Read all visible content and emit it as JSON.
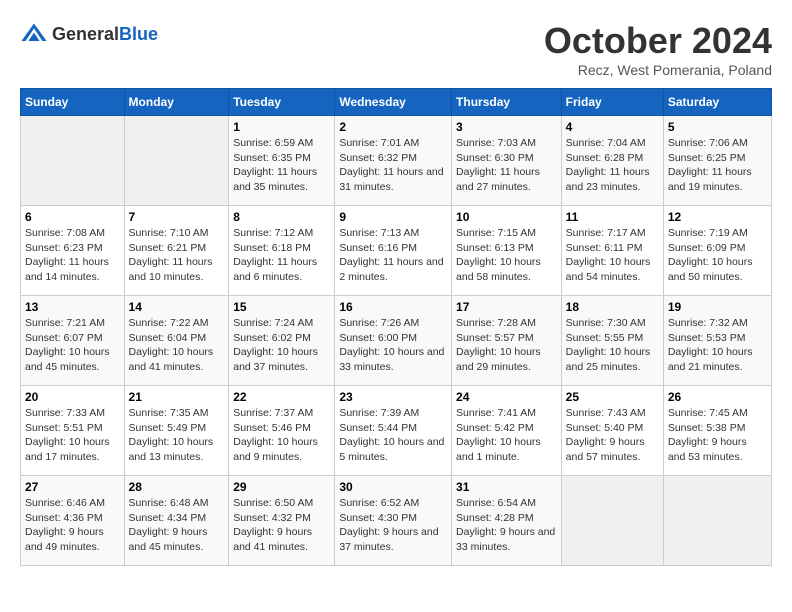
{
  "header": {
    "logo_general": "General",
    "logo_blue": "Blue",
    "title": "October 2024",
    "location": "Recz, West Pomerania, Poland"
  },
  "columns": [
    "Sunday",
    "Monday",
    "Tuesday",
    "Wednesday",
    "Thursday",
    "Friday",
    "Saturday"
  ],
  "weeks": [
    [
      {
        "day": "",
        "empty": true
      },
      {
        "day": "",
        "empty": true
      },
      {
        "day": "1",
        "sunrise": "Sunrise: 6:59 AM",
        "sunset": "Sunset: 6:35 PM",
        "daylight": "Daylight: 11 hours and 35 minutes."
      },
      {
        "day": "2",
        "sunrise": "Sunrise: 7:01 AM",
        "sunset": "Sunset: 6:32 PM",
        "daylight": "Daylight: 11 hours and 31 minutes."
      },
      {
        "day": "3",
        "sunrise": "Sunrise: 7:03 AM",
        "sunset": "Sunset: 6:30 PM",
        "daylight": "Daylight: 11 hours and 27 minutes."
      },
      {
        "day": "4",
        "sunrise": "Sunrise: 7:04 AM",
        "sunset": "Sunset: 6:28 PM",
        "daylight": "Daylight: 11 hours and 23 minutes."
      },
      {
        "day": "5",
        "sunrise": "Sunrise: 7:06 AM",
        "sunset": "Sunset: 6:25 PM",
        "daylight": "Daylight: 11 hours and 19 minutes."
      }
    ],
    [
      {
        "day": "6",
        "sunrise": "Sunrise: 7:08 AM",
        "sunset": "Sunset: 6:23 PM",
        "daylight": "Daylight: 11 hours and 14 minutes."
      },
      {
        "day": "7",
        "sunrise": "Sunrise: 7:10 AM",
        "sunset": "Sunset: 6:21 PM",
        "daylight": "Daylight: 11 hours and 10 minutes."
      },
      {
        "day": "8",
        "sunrise": "Sunrise: 7:12 AM",
        "sunset": "Sunset: 6:18 PM",
        "daylight": "Daylight: 11 hours and 6 minutes."
      },
      {
        "day": "9",
        "sunrise": "Sunrise: 7:13 AM",
        "sunset": "Sunset: 6:16 PM",
        "daylight": "Daylight: 11 hours and 2 minutes."
      },
      {
        "day": "10",
        "sunrise": "Sunrise: 7:15 AM",
        "sunset": "Sunset: 6:13 PM",
        "daylight": "Daylight: 10 hours and 58 minutes."
      },
      {
        "day": "11",
        "sunrise": "Sunrise: 7:17 AM",
        "sunset": "Sunset: 6:11 PM",
        "daylight": "Daylight: 10 hours and 54 minutes."
      },
      {
        "day": "12",
        "sunrise": "Sunrise: 7:19 AM",
        "sunset": "Sunset: 6:09 PM",
        "daylight": "Daylight: 10 hours and 50 minutes."
      }
    ],
    [
      {
        "day": "13",
        "sunrise": "Sunrise: 7:21 AM",
        "sunset": "Sunset: 6:07 PM",
        "daylight": "Daylight: 10 hours and 45 minutes."
      },
      {
        "day": "14",
        "sunrise": "Sunrise: 7:22 AM",
        "sunset": "Sunset: 6:04 PM",
        "daylight": "Daylight: 10 hours and 41 minutes."
      },
      {
        "day": "15",
        "sunrise": "Sunrise: 7:24 AM",
        "sunset": "Sunset: 6:02 PM",
        "daylight": "Daylight: 10 hours and 37 minutes."
      },
      {
        "day": "16",
        "sunrise": "Sunrise: 7:26 AM",
        "sunset": "Sunset: 6:00 PM",
        "daylight": "Daylight: 10 hours and 33 minutes."
      },
      {
        "day": "17",
        "sunrise": "Sunrise: 7:28 AM",
        "sunset": "Sunset: 5:57 PM",
        "daylight": "Daylight: 10 hours and 29 minutes."
      },
      {
        "day": "18",
        "sunrise": "Sunrise: 7:30 AM",
        "sunset": "Sunset: 5:55 PM",
        "daylight": "Daylight: 10 hours and 25 minutes."
      },
      {
        "day": "19",
        "sunrise": "Sunrise: 7:32 AM",
        "sunset": "Sunset: 5:53 PM",
        "daylight": "Daylight: 10 hours and 21 minutes."
      }
    ],
    [
      {
        "day": "20",
        "sunrise": "Sunrise: 7:33 AM",
        "sunset": "Sunset: 5:51 PM",
        "daylight": "Daylight: 10 hours and 17 minutes."
      },
      {
        "day": "21",
        "sunrise": "Sunrise: 7:35 AM",
        "sunset": "Sunset: 5:49 PM",
        "daylight": "Daylight: 10 hours and 13 minutes."
      },
      {
        "day": "22",
        "sunrise": "Sunrise: 7:37 AM",
        "sunset": "Sunset: 5:46 PM",
        "daylight": "Daylight: 10 hours and 9 minutes."
      },
      {
        "day": "23",
        "sunrise": "Sunrise: 7:39 AM",
        "sunset": "Sunset: 5:44 PM",
        "daylight": "Daylight: 10 hours and 5 minutes."
      },
      {
        "day": "24",
        "sunrise": "Sunrise: 7:41 AM",
        "sunset": "Sunset: 5:42 PM",
        "daylight": "Daylight: 10 hours and 1 minute."
      },
      {
        "day": "25",
        "sunrise": "Sunrise: 7:43 AM",
        "sunset": "Sunset: 5:40 PM",
        "daylight": "Daylight: 9 hours and 57 minutes."
      },
      {
        "day": "26",
        "sunrise": "Sunrise: 7:45 AM",
        "sunset": "Sunset: 5:38 PM",
        "daylight": "Daylight: 9 hours and 53 minutes."
      }
    ],
    [
      {
        "day": "27",
        "sunrise": "Sunrise: 6:46 AM",
        "sunset": "Sunset: 4:36 PM",
        "daylight": "Daylight: 9 hours and 49 minutes."
      },
      {
        "day": "28",
        "sunrise": "Sunrise: 6:48 AM",
        "sunset": "Sunset: 4:34 PM",
        "daylight": "Daylight: 9 hours and 45 minutes."
      },
      {
        "day": "29",
        "sunrise": "Sunrise: 6:50 AM",
        "sunset": "Sunset: 4:32 PM",
        "daylight": "Daylight: 9 hours and 41 minutes."
      },
      {
        "day": "30",
        "sunrise": "Sunrise: 6:52 AM",
        "sunset": "Sunset: 4:30 PM",
        "daylight": "Daylight: 9 hours and 37 minutes."
      },
      {
        "day": "31",
        "sunrise": "Sunrise: 6:54 AM",
        "sunset": "Sunset: 4:28 PM",
        "daylight": "Daylight: 9 hours and 33 minutes."
      },
      {
        "day": "",
        "empty": true
      },
      {
        "day": "",
        "empty": true
      }
    ]
  ]
}
